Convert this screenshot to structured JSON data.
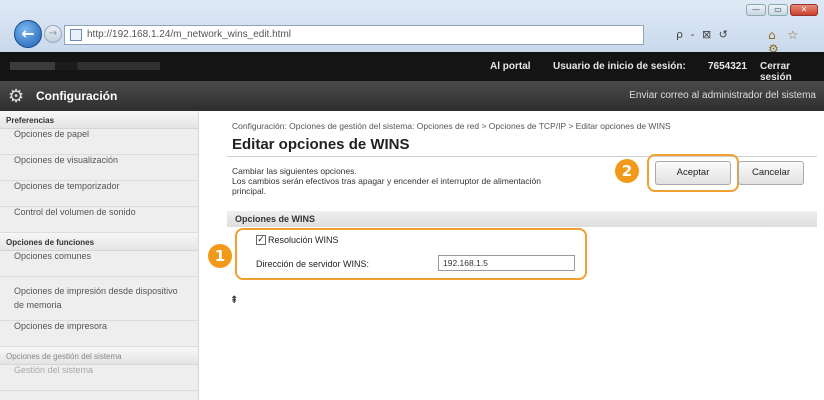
{
  "browser": {
    "url": "http://192.168.1.24/m_network_wins_edit.html",
    "address_tools": "ρ - ⊠ ↺",
    "fav_tools": "⌂ ☆ ⚙",
    "win_buttons": [
      "—",
      "▭",
      "✕"
    ]
  },
  "topbar": {
    "portal": "Al portal",
    "user_label": "Usuario de inicio de sesión:",
    "user_id": "7654321",
    "logout": "Cerrar sesión"
  },
  "header": {
    "title": "Configuración",
    "mail_link": "Enviar correo al administrador del sistema"
  },
  "sidebar": {
    "section_preferences": "Preferencias",
    "pref_items": [
      "Opciones de papel",
      "Opciones de visualización",
      "Opciones de temporizador",
      "Control del volumen de sonido"
    ],
    "section_functions": "Opciones de funciones",
    "func_items": [
      "Opciones comunes",
      "Opciones de impresión desde dispositivo de memoria",
      "Opciones de impresora"
    ],
    "section_system": "Opciones de gestión del sistema",
    "system_items": [
      "Gestión del sistema"
    ]
  },
  "main": {
    "breadcrumb": "Configuración: Opciones de gestión del sistema: Opciones de red > Opciones de TCP/IP > Editar opciones de WINS",
    "title": "Editar opciones de WINS",
    "desc_line1": "Cambiar las siguientes opciones.",
    "desc_line2": "Los cambios serán efectivos tras apagar y encender el interruptor de alimentación",
    "desc_line3": "principal.",
    "ok_label": "Aceptar",
    "cancel_label": "Cancelar",
    "badge_ok": "2",
    "badge_opts": "1",
    "section_title": "Opciones de WINS",
    "resolution_label": "Resolución WINS",
    "resolution_checked": true,
    "server_label": "Dirección de servidor WINS:",
    "server_value": "192.168.1.5",
    "to_top": "⇞"
  }
}
